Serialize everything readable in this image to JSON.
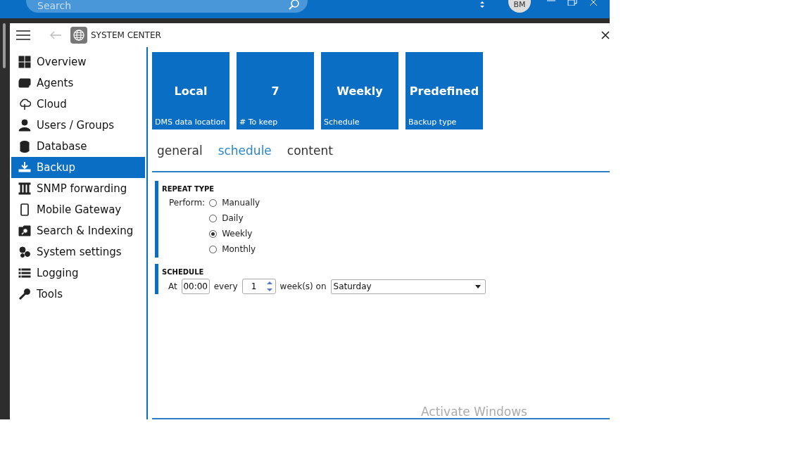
{
  "top_bar": {
    "search": {
      "placeholder": "Search"
    },
    "avatar": "BM"
  },
  "window": {
    "title": "SYSTEM CENTER"
  },
  "sidebar": {
    "items": [
      {
        "label": "Overview",
        "selected": false
      },
      {
        "label": "Agents",
        "selected": false
      },
      {
        "label": "Cloud",
        "selected": false
      },
      {
        "label": "Users / Groups",
        "selected": false
      },
      {
        "label": "Database",
        "selected": false
      },
      {
        "label": "Backup",
        "selected": true
      },
      {
        "label": "SNMP forwarding",
        "selected": false
      },
      {
        "label": "Mobile Gateway",
        "selected": false
      },
      {
        "label": "Search & Indexing",
        "selected": false
      },
      {
        "label": "System settings",
        "selected": false
      },
      {
        "label": "Logging",
        "selected": false
      },
      {
        "label": "Tools",
        "selected": false
      }
    ]
  },
  "tiles": [
    {
      "value": "Local",
      "label": "DMS data location"
    },
    {
      "value": "7",
      "label": "# To keep"
    },
    {
      "value": "Weekly",
      "label": "Schedule"
    },
    {
      "value": "Predefined",
      "label": "Backup type"
    }
  ],
  "tabs": [
    {
      "label": "general",
      "selected": false
    },
    {
      "label": "schedule",
      "selected": true
    },
    {
      "label": "content",
      "selected": false
    }
  ],
  "repeat_type": {
    "title": "REPEAT TYPE",
    "label": "Perform:",
    "options": [
      {
        "label": "Manually",
        "selected": false
      },
      {
        "label": "Daily",
        "selected": false
      },
      {
        "label": "Weekly",
        "selected": true
      },
      {
        "label": "Monthly",
        "selected": false
      }
    ]
  },
  "schedule": {
    "title": "SCHEDULE",
    "at_label": "At",
    "time": "00:00",
    "every_label": "every",
    "interval": "1",
    "unit_label": "week(s) on",
    "day": "Saturday"
  },
  "activation_notice": "Activate Windows"
}
